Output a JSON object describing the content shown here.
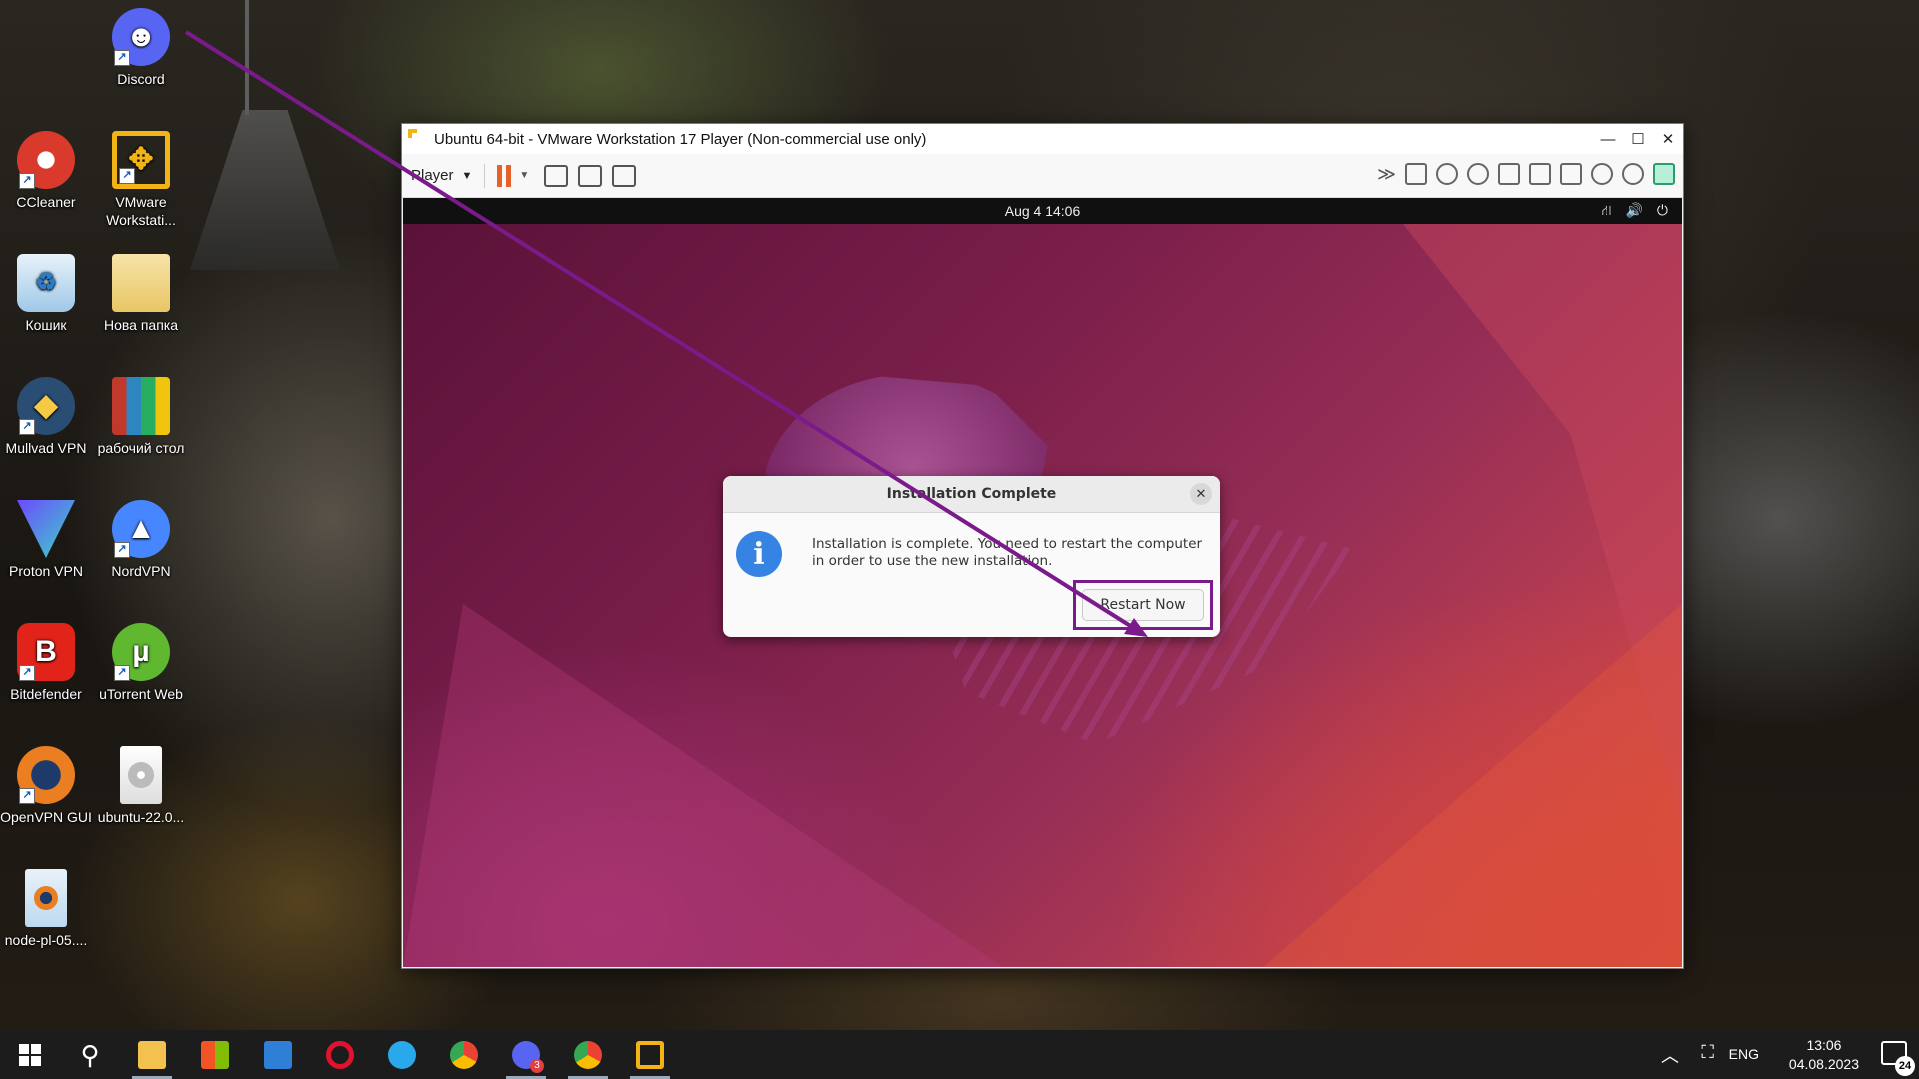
{
  "desktop": {
    "icons": [
      {
        "label": "Discord",
        "glyph": "discord-icon",
        "color": "#5865f2"
      },
      {
        "label": "CCleaner",
        "glyph": "ccleaner-icon",
        "color": "#d93a2b"
      },
      {
        "label": "VMware Workstati...",
        "glyph": "vmware-icon",
        "color": "#f2b316"
      },
      {
        "label": "Кошик",
        "glyph": "recycle-bin-icon",
        "color": "#9fc8e8"
      },
      {
        "label": "Нова папка",
        "glyph": "folder-icon",
        "color": "#f0d58a"
      },
      {
        "label": "Mullvad VPN",
        "glyph": "mullvad-icon",
        "color": "#294d73"
      },
      {
        "label": "рабочий стол",
        "glyph": "archive-icon",
        "color": "#c0392b"
      },
      {
        "label": "Proton VPN",
        "glyph": "protonvpn-icon",
        "color": "#6d4aff"
      },
      {
        "label": "NordVPN",
        "glyph": "nordvpn-icon",
        "color": "#4687ff"
      },
      {
        "label": "Bitdefender",
        "glyph": "bitdefender-icon",
        "color": "#e2231a"
      },
      {
        "label": "uTorrent Web",
        "glyph": "utorrent-icon",
        "color": "#5fb830"
      },
      {
        "label": "OpenVPN GUI",
        "glyph": "openvpn-icon",
        "color": "#ea7e20"
      },
      {
        "label": "ubuntu-22.0...",
        "glyph": "disc-image-icon",
        "color": "#dddddd"
      },
      {
        "label": "node-pl-05....",
        "glyph": "ovpn-file-icon",
        "color": "#3b8fd9"
      }
    ]
  },
  "vmware": {
    "title": "Ubuntu 64-bit - VMware Workstation 17 Player (Non-commercial use only)",
    "player_menu": "Player",
    "accent": "#e6602a"
  },
  "guest": {
    "topbar_clock": "Aug 4  14:06",
    "dialog": {
      "title": "Installation Complete",
      "message": "Installation is complete. You need to restart the computer in order to use the new installation.",
      "button": "Restart Now"
    }
  },
  "taskbar": {
    "lang": "ENG",
    "time": "13:06",
    "date": "04.08.2023",
    "notif_count": "24",
    "discord_badge": "3"
  },
  "annotation_color": "#7b1a8a"
}
